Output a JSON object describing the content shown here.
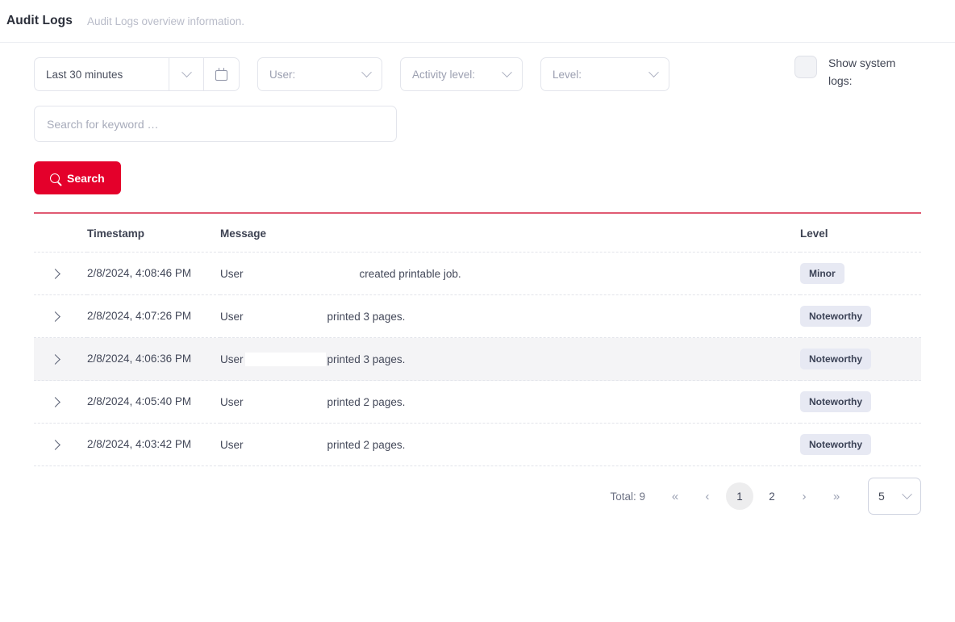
{
  "header": {
    "title": "Audit Logs",
    "subtitle": "Audit Logs overview information."
  },
  "filters": {
    "date_range_value": "Last 30 minutes",
    "date_chevron_icon": "chevron-down-icon",
    "calendar_icon": "calendar-icon",
    "user_label": "User:",
    "activity_level_label": "Activity level:",
    "level_label": "Level:",
    "show_system_logs_label": "Show system logs:",
    "show_system_logs_checked": false
  },
  "search": {
    "placeholder": "Search for keyword …",
    "value": "",
    "button_label": "Search",
    "button_icon": "search-icon",
    "button_color": "#e4002b"
  },
  "table": {
    "columns": [
      "Timestamp",
      "Message",
      "Level"
    ],
    "rows": [
      {
        "expand_icon": "chevron-right-icon",
        "timestamp": "2/8/2024, 4:08:46 PM",
        "message_prefix": "User",
        "message_redacted_width": 140,
        "message_suffix": "created printable job.",
        "level": "Minor",
        "highlighted": false
      },
      {
        "expand_icon": "chevron-right-icon",
        "timestamp": "2/8/2024, 4:07:26 PM",
        "message_prefix": "User",
        "message_redacted_width": 100,
        "message_suffix": "printed 3 pages.",
        "level": "Noteworthy",
        "highlighted": false
      },
      {
        "expand_icon": "chevron-right-icon",
        "timestamp": "2/8/2024, 4:06:36 PM",
        "message_prefix": "User",
        "message_redacted_width": 100,
        "message_suffix": "printed 3 pages.",
        "level": "Noteworthy",
        "highlighted": true
      },
      {
        "expand_icon": "chevron-right-icon",
        "timestamp": "2/8/2024, 4:05:40 PM",
        "message_prefix": "User",
        "message_redacted_width": 100,
        "message_suffix": "printed 2 pages.",
        "level": "Noteworthy",
        "highlighted": false
      },
      {
        "expand_icon": "chevron-right-icon",
        "timestamp": "2/8/2024, 4:03:42 PM",
        "message_prefix": "User",
        "message_redacted_width": 100,
        "message_suffix": "printed 2 pages.",
        "level": "Noteworthy",
        "highlighted": false
      }
    ]
  },
  "pagination": {
    "total_label": "Total: 9",
    "first_icon": "«",
    "prev_icon": "‹",
    "pages": [
      "1",
      "2"
    ],
    "active_page": "1",
    "next_icon": "›",
    "last_icon": "»",
    "page_size_value": "5",
    "page_size_chevron_icon": "chevron-down-icon"
  }
}
